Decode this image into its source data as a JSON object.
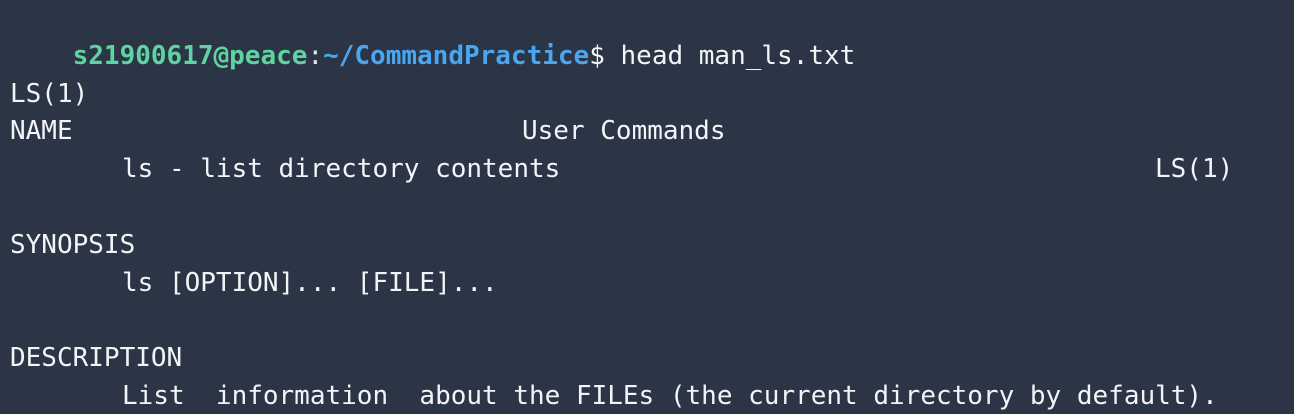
{
  "prompt": {
    "user_host": "s21900617@peace",
    "separator": ":",
    "path": "~/CommandPractice",
    "symbol": "$",
    "command": " head man_ls.txt"
  },
  "man_header": {
    "left": "LS(1)",
    "center": "User Commands",
    "right": "LS(1)"
  },
  "sections": {
    "name_heading": "NAME",
    "name_body": "ls - list directory contents",
    "synopsis_heading": "SYNOPSIS",
    "synopsis_body": "ls [OPTION]... [FILE]...",
    "description_heading": "DESCRIPTION",
    "description_body": "List  information  about the FILEs (the current directory by default)."
  }
}
